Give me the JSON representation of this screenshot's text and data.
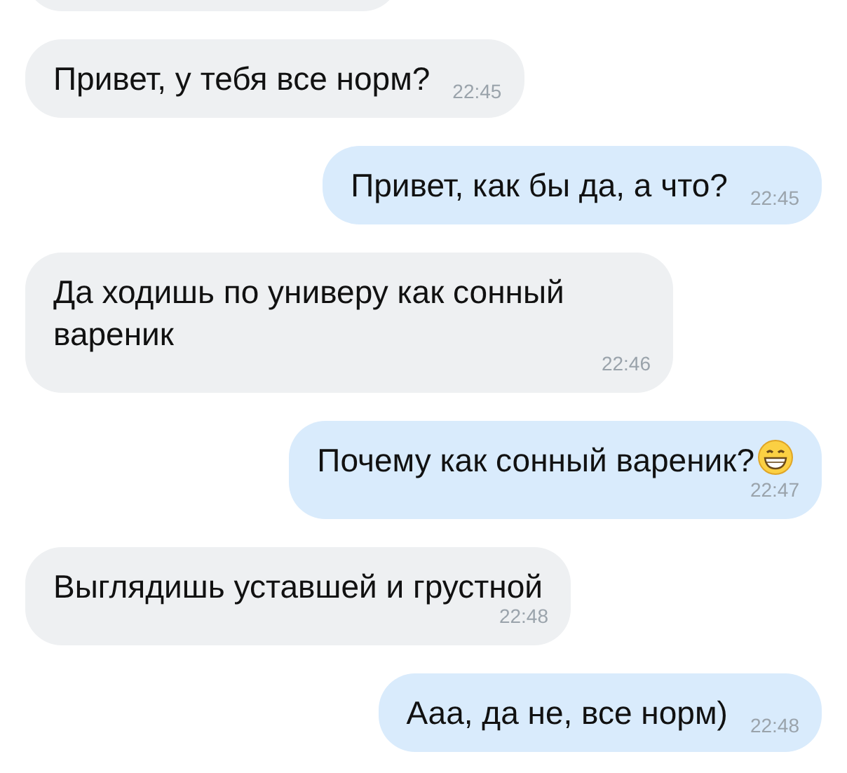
{
  "messages": [
    {
      "kind": "incoming_cut"
    },
    {
      "kind": "incoming",
      "text": "Привет, у тебя все норм?",
      "time": "22:45",
      "time_below": false
    },
    {
      "kind": "outgoing",
      "text": "Привет, как бы да, а что?",
      "time": "22:45",
      "time_below": false
    },
    {
      "kind": "incoming",
      "text": "Да ходишь по универу как сонный вареник",
      "time": "22:46",
      "time_below": true
    },
    {
      "kind": "outgoing",
      "text": "Почему как сонный вареник?",
      "has_emoji": true,
      "time": "22:47",
      "time_below": true
    },
    {
      "kind": "incoming",
      "text": "Выглядишь уставшей и грустной",
      "time": "22:48",
      "time_below": true
    },
    {
      "kind": "outgoing",
      "text": "Ааа, да не, все норм)",
      "time": "22:48",
      "time_below": false
    }
  ]
}
